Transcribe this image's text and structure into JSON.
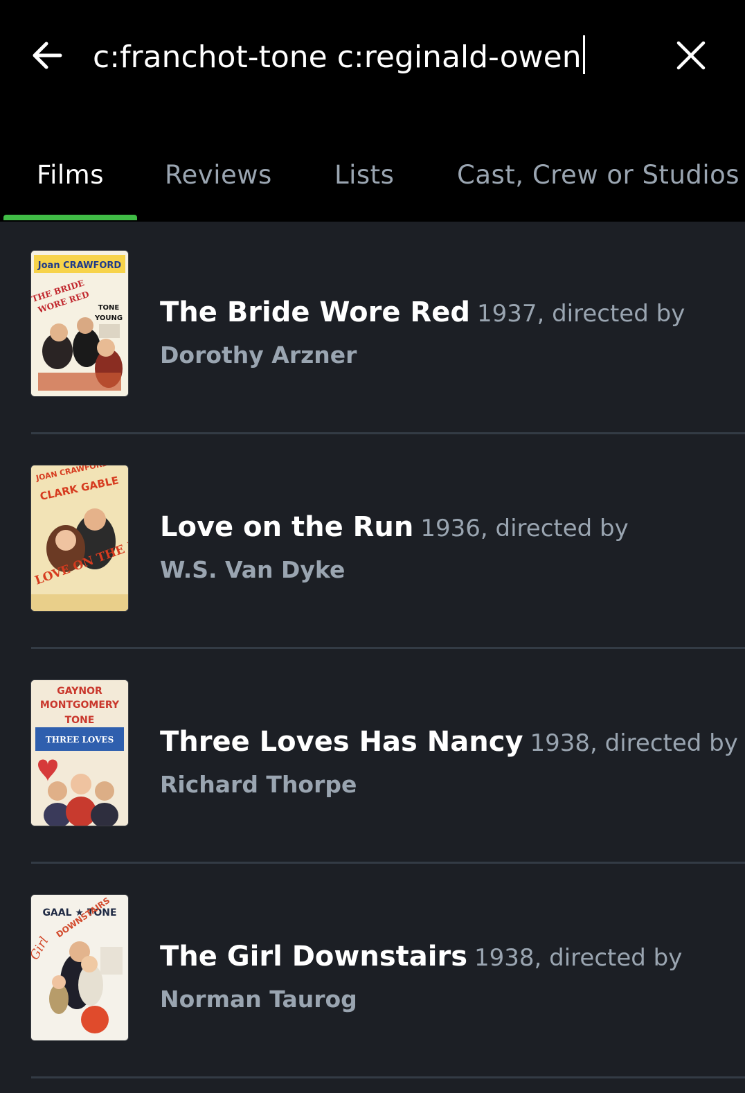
{
  "search": {
    "query": "c:franchot-tone c:reginald-owen"
  },
  "icons": {
    "back": "arrow-left-icon",
    "clear": "close-icon"
  },
  "tabs": [
    {
      "label": "Films",
      "active": true
    },
    {
      "label": "Reviews",
      "active": false
    },
    {
      "label": "Lists",
      "active": false
    },
    {
      "label": "Cast, Crew or Studios",
      "active": false
    }
  ],
  "colors": {
    "accent": "#40bc46",
    "background": "#1c1f25",
    "topbar": "#000000",
    "muted_text": "#9aa5b1"
  },
  "results": [
    {
      "title": "The Bride Wore Red",
      "meta": "1937, directed by",
      "director": "Dorothy Arzner",
      "poster": {
        "top_text": "Joan CRAWFORD",
        "headline": "THE BRIDE WORE RED",
        "side": "TONE YOUNG"
      }
    },
    {
      "title": "Love on the Run",
      "meta": "1936, directed by",
      "director": "W.S. Van Dyke",
      "poster": {
        "top_text": "JOAN CRAWFORD",
        "headline": "CLARK GABLE",
        "side": "LOVE ON THE RUN"
      }
    },
    {
      "title": "Three Loves Has Nancy",
      "meta": "1938, directed by",
      "director": "Richard Thorpe",
      "poster": {
        "top_text": "GAYNOR",
        "headline": "MONTGOMERY",
        "side": "TONE"
      }
    },
    {
      "title": "The Girl Downstairs",
      "meta": "1938, directed by",
      "director": "Norman Taurog",
      "poster": {
        "top_text": "GAAL ★ TONE",
        "headline": "DOWNSTAIRS",
        "side": "Girl"
      }
    }
  ]
}
